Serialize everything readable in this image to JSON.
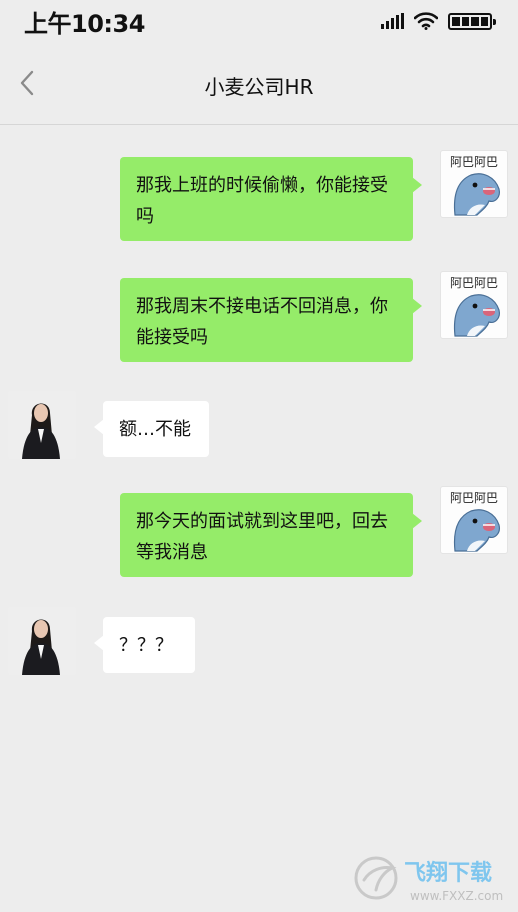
{
  "status_bar": {
    "time": "上午10:34"
  },
  "header": {
    "title": "小麦公司HR"
  },
  "messages": [
    {
      "side": "right",
      "text": "那我上班的时候偷懒，你能接受吗"
    },
    {
      "side": "right",
      "text": "那我周末不接电话不回消息，你能接受吗"
    },
    {
      "side": "left",
      "text": "额…不能"
    },
    {
      "side": "right",
      "text": "那今天的面试就到这里吧，回去等我消息"
    },
    {
      "side": "left",
      "text": "？？？"
    }
  ],
  "sticker_text": "阿巴阿巴",
  "watermark": {
    "brand": "飞翔下载",
    "url": "www.FXXZ.com"
  },
  "colors": {
    "background": "#ededed",
    "self_bubble": "#95ec69",
    "other_bubble": "#ffffff",
    "sticker_blue": "#7fa7cf"
  }
}
